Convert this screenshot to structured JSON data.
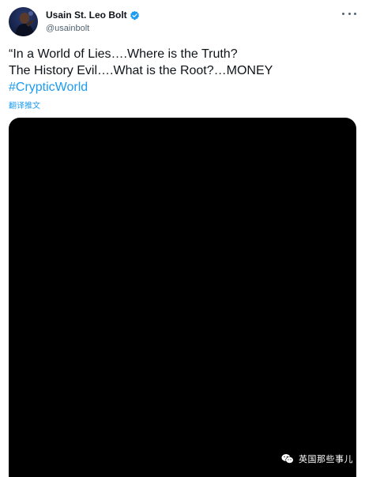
{
  "tweet": {
    "author": {
      "display_name": "Usain St. Leo Bolt",
      "handle": "@usainbolt",
      "verified": true
    },
    "text_lines": [
      "“In a World of Lies….Where is the Truth?",
      "The History Evil….What is the Root?…MONEY"
    ],
    "hashtag": "#CrypticWorld",
    "translate_label": "翻译推文"
  },
  "watermark": {
    "text": "英国那些事儿",
    "icon": "wechat-icon"
  },
  "colors": {
    "link": "#1d9bf0",
    "verified": "#1d9bf0",
    "media_background": "#000000",
    "secondary_text": "#536471"
  },
  "icons": {
    "verified": "verified-badge-icon",
    "more": "more-options-icon"
  }
}
